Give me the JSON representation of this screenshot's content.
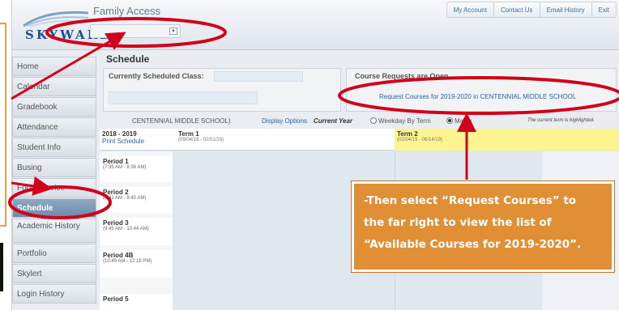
{
  "app": {
    "logo_text": "SKYWARD",
    "title": "Family Access",
    "district_select_value": ""
  },
  "top_links": [
    "My Account",
    "Contact Us",
    "Email History",
    "Exit"
  ],
  "sidebar": {
    "items": [
      {
        "label": "Home"
      },
      {
        "label": "Calendar"
      },
      {
        "label": "Gradebook"
      },
      {
        "label": "Attendance"
      },
      {
        "label": "Student Info"
      },
      {
        "label": "Busing"
      },
      {
        "label": "Food Service"
      },
      {
        "label": "Schedule",
        "active": true
      },
      {
        "label": "Academic History"
      },
      {
        "label": "Portfolio"
      },
      {
        "label": "Skylert"
      },
      {
        "label": "Login History"
      }
    ]
  },
  "schedule": {
    "page_title": "Schedule",
    "current_class_label": "Currently Scheduled Class:",
    "course_requests_label": "Course Requests are Open",
    "request_link": "Request Courses for 2019-2020 in CENTENNIAL MIDDLE SCHOOL",
    "school_label": "CENTENNIAL MIDDLE SCHOOL)",
    "display_options": "Display Options",
    "current_year": "Current Year",
    "weekday_by_term": "Weekday By Term",
    "matrix": "Matrix",
    "highlight_note": "The current term is highlighted.",
    "year": "2018 - 2019",
    "print_schedule": "Print Schedule",
    "terms": [
      {
        "name": "Term 1",
        "dates": "(09/04/18 - 02/01/19)"
      },
      {
        "name": "Term 2",
        "dates": "(02/04/19 - 06/14/19)"
      }
    ],
    "periods": [
      {
        "name": "Period 1",
        "time": "(7:35 AM - 8:36 AM)"
      },
      {
        "name": "Period 2",
        "time": "(8:41 AM - 9:40 AM)"
      },
      {
        "name": "Period 3",
        "time": "(9:45 AM - 10:44 AM)"
      },
      {
        "name": "Period 4B",
        "time": "(10:49 AM - 12:18 PM)"
      },
      {
        "name": "Period 5",
        "time": ""
      }
    ]
  },
  "callout": {
    "line1": "-Then select “Request Courses” to",
    "line2": "the far right to view the list of",
    "line3": "“Available Courses for 2019-2020”."
  },
  "colors": {
    "annotation_red": "#d0021b",
    "callout_orange": "#e08f34",
    "term_highlight": "#fcf58f",
    "sidebar_active": "#7a96b6"
  }
}
